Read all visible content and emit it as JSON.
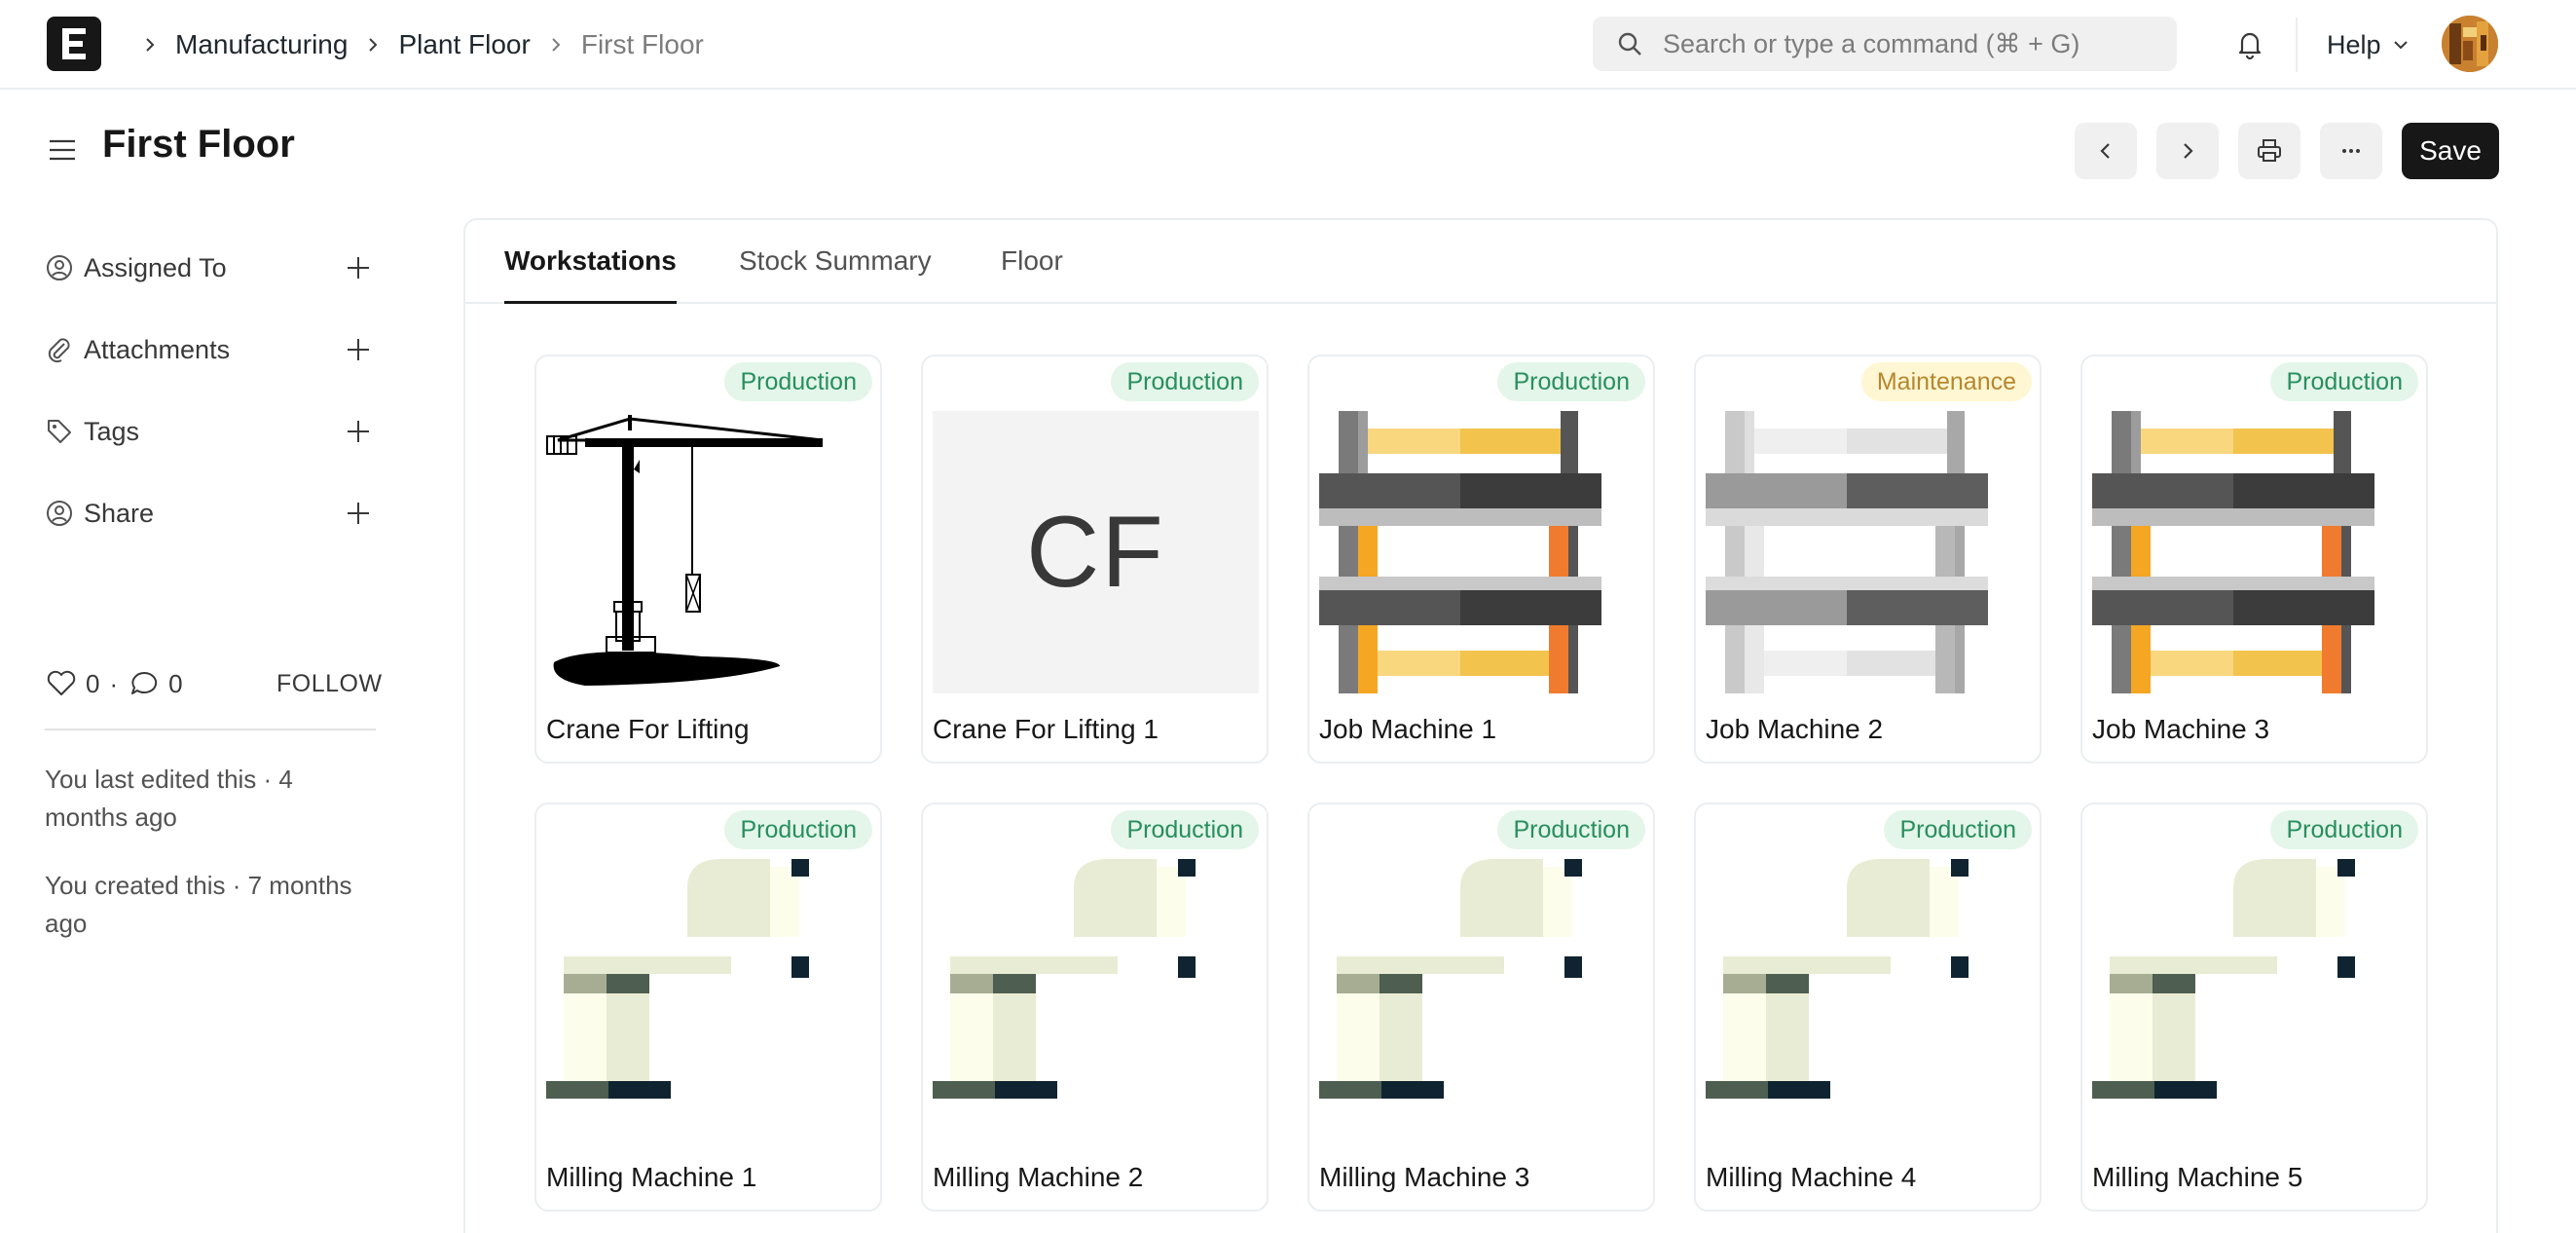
{
  "navbar": {
    "logo_letter": "E",
    "breadcrumbs": [
      "Manufacturing",
      "Plant Floor",
      "First Floor"
    ],
    "search_placeholder": "Search or type a command (⌘ + G)",
    "help_label": "Help"
  },
  "header": {
    "title": "First Floor",
    "save_label": "Save"
  },
  "sidebar": {
    "items": [
      {
        "label": "Assigned To",
        "icon": "assign-icon"
      },
      {
        "label": "Attachments",
        "icon": "paperclip-icon"
      },
      {
        "label": "Tags",
        "icon": "tag-icon"
      },
      {
        "label": "Share",
        "icon": "share-icon"
      }
    ],
    "likes": "0",
    "comments": "0",
    "follow_label": "FOLLOW",
    "last_edited": "You last edited this · 4 months ago",
    "created": "You created this · 7 months ago"
  },
  "tabs": [
    {
      "label": "Workstations",
      "active": true
    },
    {
      "label": "Stock Summary",
      "active": false
    },
    {
      "label": "Floor",
      "active": false
    }
  ],
  "workstations": [
    {
      "name": "Crane For Lifting",
      "status": "Production",
      "image": "crane"
    },
    {
      "name": "Crane For Lifting 1",
      "status": "Production",
      "image": "initials",
      "initials": "CF"
    },
    {
      "name": "Job Machine 1",
      "status": "Production",
      "image": "job-machine"
    },
    {
      "name": "Job Machine 2",
      "status": "Maintenance",
      "image": "job-machine-gray"
    },
    {
      "name": "Job Machine 3",
      "status": "Production",
      "image": "job-machine"
    },
    {
      "name": "Milling Machine 1",
      "status": "Production",
      "image": "milling"
    },
    {
      "name": "Milling Machine 2",
      "status": "Production",
      "image": "milling"
    },
    {
      "name": "Milling Machine 3",
      "status": "Production",
      "image": "milling"
    },
    {
      "name": "Milling Machine 4",
      "status": "Production",
      "image": "milling"
    },
    {
      "name": "Milling Machine 5",
      "status": "Production",
      "image": "milling"
    }
  ],
  "colors": {
    "production_bg": "#e4f5e9",
    "production_text": "#278f5e",
    "maintenance_bg": "#fff7d3",
    "maintenance_text": "#b7862d",
    "primary": "#171717"
  }
}
